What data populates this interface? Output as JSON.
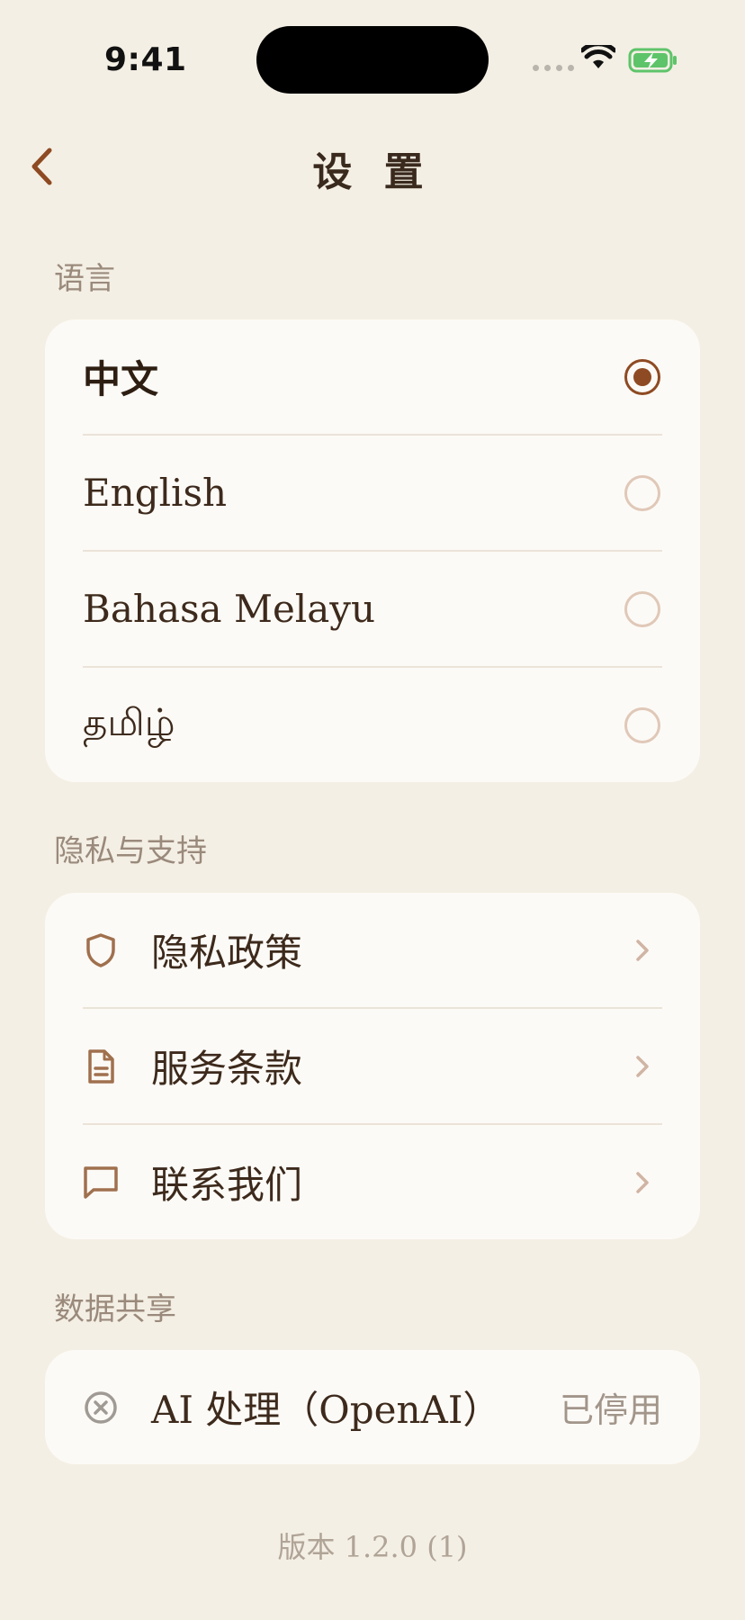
{
  "status_bar": {
    "time": "9:41"
  },
  "nav": {
    "title": "设 置"
  },
  "language": {
    "section_label": "语言",
    "options": [
      {
        "label": "中文",
        "selected": true
      },
      {
        "label": "English",
        "selected": false
      },
      {
        "label": "Bahasa Melayu",
        "selected": false
      },
      {
        "label": "தமிழ்",
        "selected": false
      }
    ]
  },
  "privacy": {
    "section_label": "隐私与支持",
    "items": [
      {
        "label": "隐私政策",
        "icon": "shield-icon"
      },
      {
        "label": "服务条款",
        "icon": "document-icon"
      },
      {
        "label": "联系我们",
        "icon": "message-icon"
      }
    ]
  },
  "data_sharing": {
    "section_label": "数据共享",
    "item": {
      "label": "AI 处理（OpenAI）",
      "status": "已停用",
      "icon": "close-circle-icon"
    }
  },
  "version": "版本 1.2.0 (1)",
  "colors": {
    "accent": "#8e4a22",
    "background": "#f4efe4",
    "card": "#fcfaf6",
    "battery": "#5ec46a"
  }
}
